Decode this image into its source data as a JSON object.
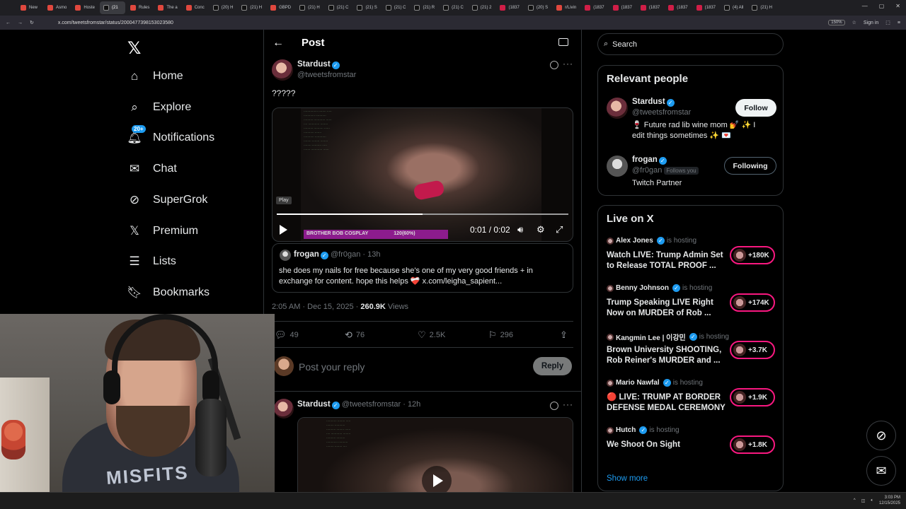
{
  "browser": {
    "tabs": [
      {
        "label": "New"
      },
      {
        "label": "Asmo"
      },
      {
        "label": "Hoste"
      },
      {
        "label": "(21",
        "active": true
      },
      {
        "label": "Rules"
      },
      {
        "label": "The a"
      },
      {
        "label": "Conc"
      },
      {
        "label": "(20) H"
      },
      {
        "label": "(21) H"
      },
      {
        "label": "GBPD"
      },
      {
        "label": "(21) H"
      },
      {
        "label": "(21) C"
      },
      {
        "label": "(21) S"
      },
      {
        "label": "(21) C"
      },
      {
        "label": "(21) R"
      },
      {
        "label": "(21) C"
      },
      {
        "label": "(21) 2"
      },
      {
        "label": "(1837"
      },
      {
        "label": "(20) S"
      },
      {
        "label": "r/Livin"
      },
      {
        "label": "(1837"
      },
      {
        "label": "(1837"
      },
      {
        "label": "(1837"
      },
      {
        "label": "(1837"
      },
      {
        "label": "(1837"
      },
      {
        "label": "(4) All"
      },
      {
        "label": "(21) H"
      }
    ],
    "url": "x.com/tweetsfromstar/status/2000477398153023580",
    "zoom": "150%",
    "signin_label": "Sign in"
  },
  "nav": {
    "logo": "𝕏",
    "items": [
      {
        "label": "Home",
        "icon": "home-icon"
      },
      {
        "label": "Explore",
        "icon": "search-icon"
      },
      {
        "label": "Notifications",
        "icon": "bell-icon",
        "badge": "20+"
      },
      {
        "label": "Chat",
        "icon": "mail-icon"
      },
      {
        "label": "SuperGrok",
        "icon": "grok-icon"
      },
      {
        "label": "Premium",
        "icon": "x-icon"
      },
      {
        "label": "Lists",
        "icon": "list-icon"
      },
      {
        "label": "Bookmarks",
        "icon": "bookmark-icon"
      }
    ]
  },
  "post": {
    "header_title": "Post",
    "author_name": "Stardust",
    "author_handle": "@tweetsfromstar",
    "text": "?????",
    "video": {
      "tooltip": "Play",
      "time": "0:01 / 0:02",
      "progress_fraction": 0.5,
      "overlay_left": "BROTHER BOB COSPLAY",
      "overlay_right": "120(60%)"
    },
    "quote": {
      "name": "frogan",
      "handle": "@fr0gan",
      "time": "13h",
      "text": "she does my nails for free because she's one of my very good friends + in exchange for content. hope this helps ❤️‍🩹 x.com/leigha_sapient..."
    },
    "meta_time": "2:05 AM · Dec 15, 2025 · ",
    "views_count": "260.9K",
    "views_label": " Views",
    "stats": {
      "replies": "49",
      "reposts": "76",
      "likes": "2.5K",
      "bookmarks": "296"
    },
    "reply_placeholder": "Post your reply",
    "reply_button": "Reply"
  },
  "reply": {
    "author_name": "Stardust",
    "author_handle": "@tweetsfromstar",
    "time": "12h"
  },
  "sidebar": {
    "search_placeholder": "Search",
    "relevant_title": "Relevant people",
    "people": [
      {
        "name": "Stardust",
        "handle": "@tweetsfromstar",
        "bio": "🍷 Future rad lib wine mom 💅 ✨ I edit things sometimes ✨ 💌",
        "button": "Follow",
        "follows_you": ""
      },
      {
        "name": "frogan",
        "handle": "@fr0gan",
        "bio": "Twitch Partner",
        "button": "Following",
        "follows_you": "Follows you"
      }
    ],
    "live_title": "Live on X",
    "live": [
      {
        "host": "Alex Jones",
        "status": "is hosting",
        "title": "Watch LIVE: Trump Admin Set to Release TOTAL PROOF ...",
        "count": "+180K"
      },
      {
        "host": "Benny Johnson",
        "status": "is hosting",
        "title": "Trump Speaking LIVE Right Now on MURDER of Rob ...",
        "count": "+174K"
      },
      {
        "host": "Kangmin Lee | 이강민",
        "status": "is hosting",
        "title": "Brown University SHOOTING, Rob Reiner's MURDER and ...",
        "count": "+3.7K"
      },
      {
        "host": "Mario Nawfal",
        "status": "is hosting",
        "title": "🔴 LIVE: TRUMP AT BORDER DEFENSE MEDAL CEREMONY",
        "count": "+1.9K"
      },
      {
        "host": "Hutch",
        "status": "is hosting",
        "title": "We Shoot On Sight",
        "count": "+1.8K"
      }
    ],
    "show_more": "Show more"
  },
  "webcam": {
    "shirt_text": "MISFITS"
  },
  "taskbar": {
    "time": "3:03 PM",
    "date": "12/15/2025"
  },
  "colors": {
    "accent": "#1d9bf0",
    "live": "#f91880",
    "background": "#000000",
    "border": "#2f3336"
  }
}
